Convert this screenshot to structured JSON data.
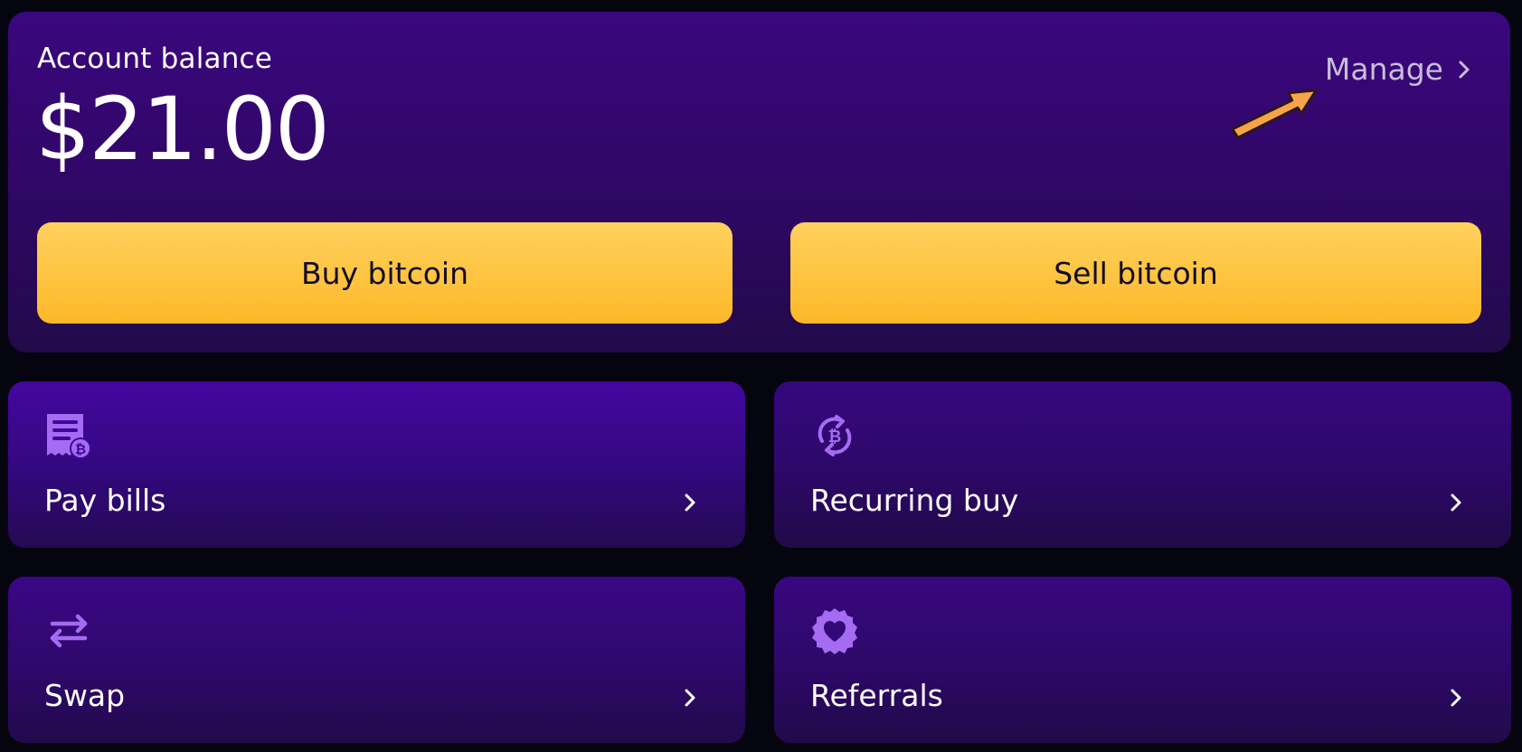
{
  "balance": {
    "label": "Account balance",
    "amount": "$21.00",
    "manage_label": "Manage"
  },
  "actions": {
    "buy_label": "Buy bitcoin",
    "sell_label": "Sell bitcoin"
  },
  "tiles": [
    {
      "label": "Pay bills",
      "icon": "bill-bitcoin-icon"
    },
    {
      "label": "Recurring buy",
      "icon": "recurring-bitcoin-icon"
    },
    {
      "label": "Swap",
      "icon": "swap-arrows-icon"
    },
    {
      "label": "Referrals",
      "icon": "heart-badge-icon"
    }
  ],
  "colors": {
    "card_purple": "#3a077e",
    "button_yellow": "#fdb828",
    "icon_lilac": "#a56cf2",
    "background": "#05050f",
    "annotation_arrow": "#f7a34a"
  }
}
